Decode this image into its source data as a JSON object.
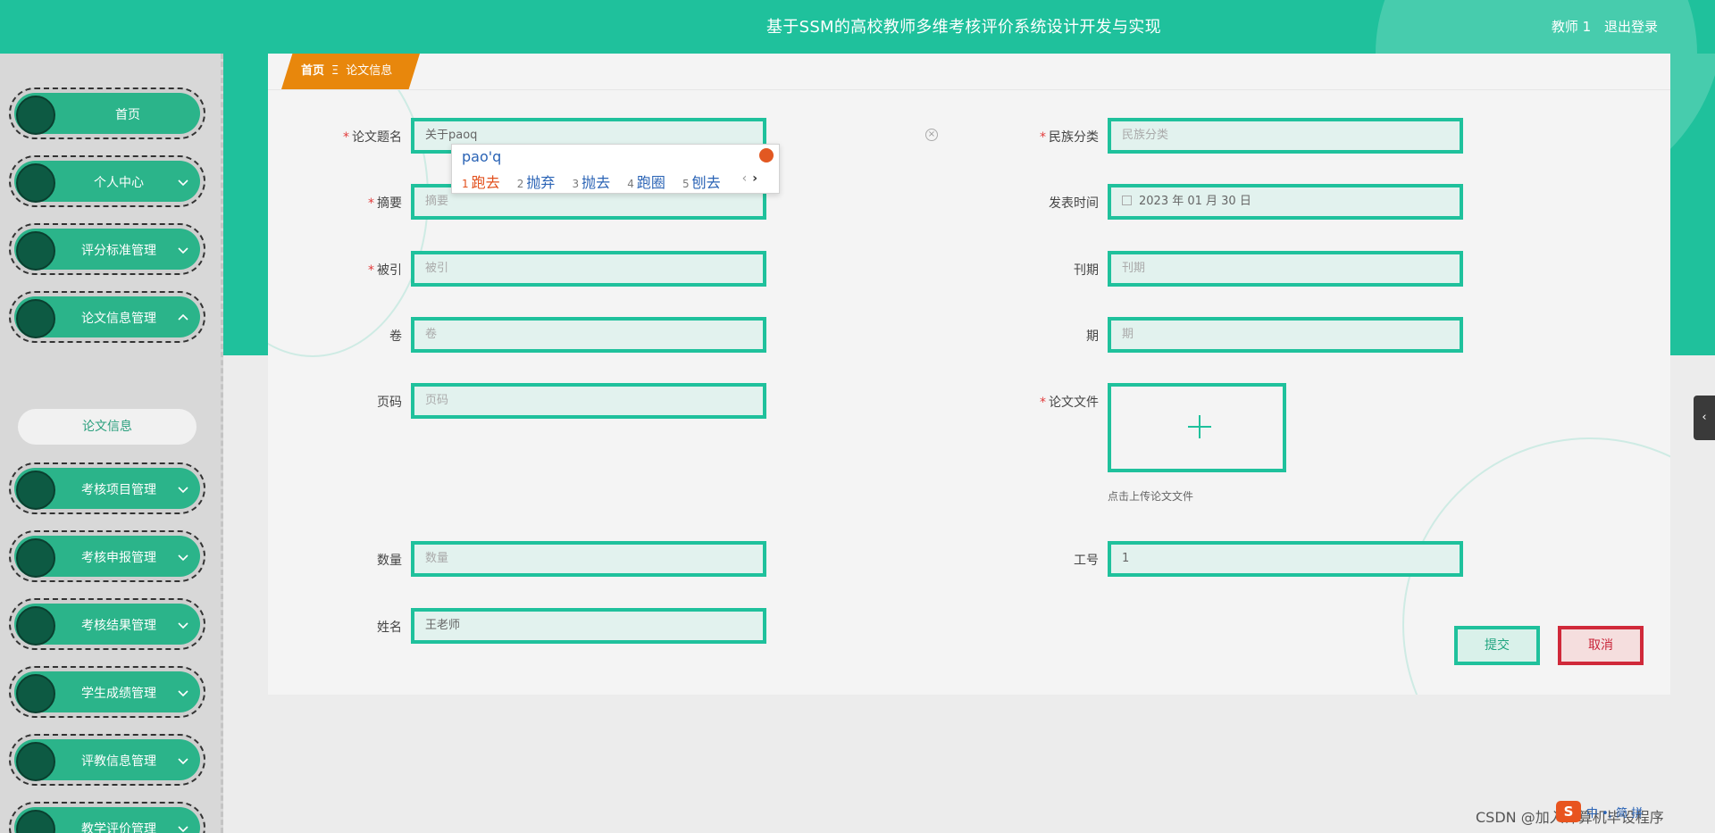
{
  "header": {
    "title": "基于SSM的高校教师多维考核评价系统设计开发与实现",
    "user": "教师 1",
    "logout": "退出登录"
  },
  "sidebar": {
    "items": [
      {
        "label": "首页",
        "has_chevron": false
      },
      {
        "label": "个人中心",
        "has_chevron": true
      },
      {
        "label": "评分标准管理",
        "has_chevron": true
      },
      {
        "label": "论文信息管理",
        "has_chevron": true,
        "expanded": true
      },
      {
        "label": "考核项目管理",
        "has_chevron": true
      },
      {
        "label": "考核申报管理",
        "has_chevron": true
      },
      {
        "label": "考核结果管理",
        "has_chevron": true
      },
      {
        "label": "学生成绩管理",
        "has_chevron": true
      },
      {
        "label": "评教信息管理",
        "has_chevron": true
      },
      {
        "label": "教学评价管理",
        "has_chevron": true
      }
    ],
    "submenu": "论文信息"
  },
  "breadcrumb": {
    "home": "首页",
    "sep": "Ξ",
    "current": "论文信息"
  },
  "form": {
    "title": {
      "label": "论文题名",
      "value": "关于paoq"
    },
    "summary": {
      "label": "摘要",
      "placeholder": "摘要"
    },
    "cited": {
      "label": "被引",
      "placeholder": "被引"
    },
    "volume": {
      "label": "卷",
      "placeholder": "卷"
    },
    "pages": {
      "label": "页码",
      "placeholder": "页码"
    },
    "count": {
      "label": "数量",
      "placeholder": "数量"
    },
    "name": {
      "label": "姓名",
      "value": "王老师"
    },
    "category": {
      "label": "民族分类",
      "placeholder": "民族分类"
    },
    "pubdate": {
      "label": "发表时间",
      "value": "2023 年 01 月 30 日"
    },
    "journal": {
      "label": "刊期",
      "placeholder": "刊期"
    },
    "issue": {
      "label": "期",
      "placeholder": "期"
    },
    "file": {
      "label": "论文文件",
      "hint": "点击上传论文文件"
    },
    "workid": {
      "label": "工号",
      "value": "1"
    }
  },
  "buttons": {
    "submit": "提交",
    "cancel": "取消"
  },
  "ime": {
    "composition": "pao'q",
    "candidates": [
      {
        "index": "1",
        "text": "跑去"
      },
      {
        "index": "2",
        "text": "抛弃"
      },
      {
        "index": "3",
        "text": "抛去"
      },
      {
        "index": "4",
        "text": "跑圈"
      },
      {
        "index": "5",
        "text": "刨去"
      }
    ]
  },
  "watermark": "CSDN @加入计算机毕设程序",
  "tray": {
    "logo": "S",
    "text": "中 •, 简 拼"
  },
  "colors": {
    "brand": "#1fc19c",
    "accent": "#e8870c",
    "danger": "#d0293a"
  }
}
